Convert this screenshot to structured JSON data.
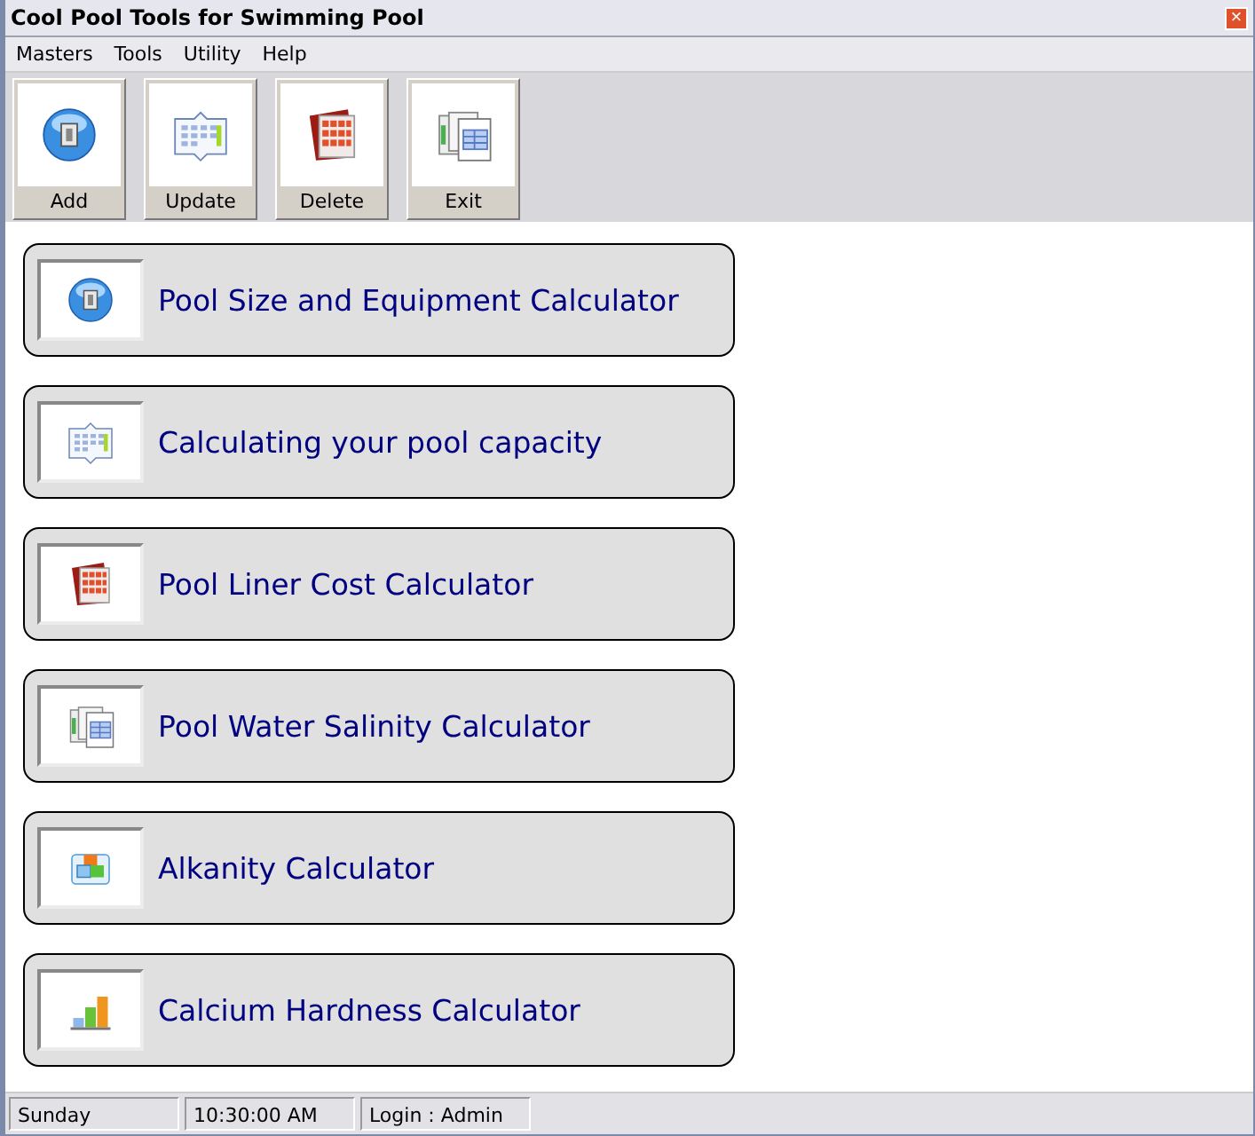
{
  "window": {
    "title": "Cool Pool Tools for Swimming Pool",
    "close": "×"
  },
  "menu": [
    "Masters",
    "Tools",
    "Utility",
    "Help"
  ],
  "toolbar": [
    "Add",
    "Update",
    "Delete",
    "Exit"
  ],
  "calculators": [
    "Pool Size and Equipment Calculator",
    "Calculating your pool capacity",
    "Pool Liner Cost Calculator",
    "Pool Water Salinity Calculator",
    "Alkanity Calculator",
    "Calcium Hardness Calculator"
  ],
  "status_bar": [
    "Sunday",
    "10:30:00 AM",
    "Login : Admin"
  ]
}
